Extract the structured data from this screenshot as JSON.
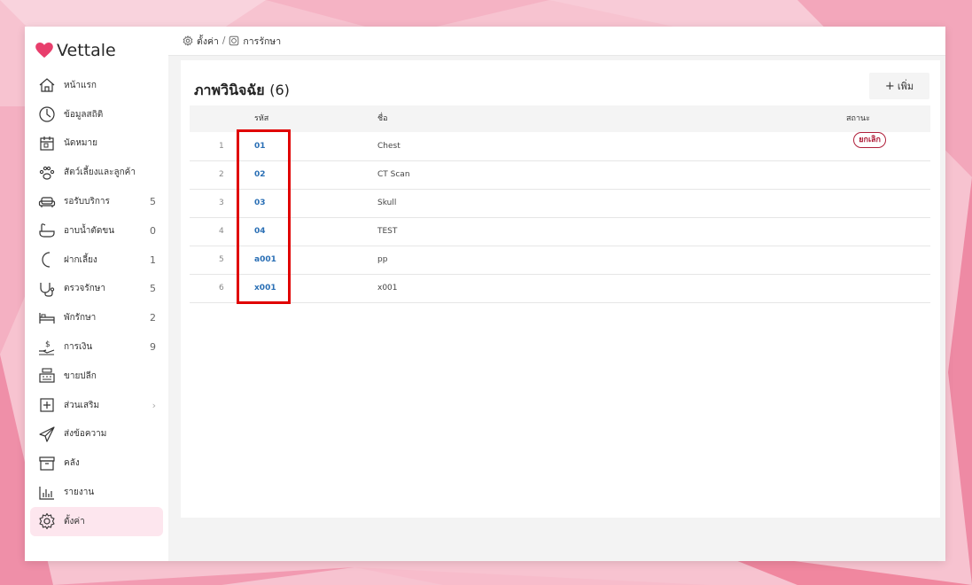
{
  "brand": {
    "name": "Vettale",
    "accent": "#e83e6c"
  },
  "sidebar": {
    "items": [
      {
        "label": "หน้าแรก",
        "count": "",
        "icon": "home-icon"
      },
      {
        "label": "ข้อมูลสถิติ",
        "count": "",
        "icon": "stats-icon"
      },
      {
        "label": "นัดหมาย",
        "count": "",
        "icon": "calendar-icon"
      },
      {
        "label": "สัตว์เลี้ยงและลูกค้า",
        "count": "",
        "icon": "paw-icon"
      },
      {
        "label": "รอรับบริการ",
        "count": "5",
        "icon": "sofa-icon"
      },
      {
        "label": "อาบน้ำตัดขน",
        "count": "0",
        "icon": "bathtub-icon"
      },
      {
        "label": "ฝากเลี้ยง",
        "count": "1",
        "icon": "moon-icon"
      },
      {
        "label": "ตรวจรักษา",
        "count": "5",
        "icon": "stethoscope-icon"
      },
      {
        "label": "พักรักษา",
        "count": "2",
        "icon": "bed-icon"
      },
      {
        "label": "การเงิน",
        "count": "9",
        "icon": "money-hand-icon"
      },
      {
        "label": "ขายปลีก",
        "count": "",
        "icon": "cash-register-icon"
      },
      {
        "label": "ส่วนเสริม",
        "count": "›",
        "icon": "plus-square-icon"
      },
      {
        "label": "ส่งข้อความ",
        "count": "",
        "icon": "send-icon"
      },
      {
        "label": "คลัง",
        "count": "",
        "icon": "archive-icon"
      },
      {
        "label": "รายงาน",
        "count": "",
        "icon": "bar-chart-icon"
      },
      {
        "label": "ตั้งค่า",
        "count": "",
        "icon": "gear-icon"
      }
    ]
  },
  "breadcrumb": {
    "settings": "ตั้งค่า",
    "separator": "/",
    "treatment": "การรักษา"
  },
  "page": {
    "title": "ภาพวินิจฉัย",
    "count": "(6)",
    "add_label": "เพิ่ม",
    "add_symbol": "+"
  },
  "table": {
    "headers": {
      "code": "รหัส",
      "name": "ชื่อ",
      "status": "สถานะ"
    },
    "rows": [
      {
        "num": "1",
        "code": "01",
        "name": "Chest",
        "status": "ยกเลิก"
      },
      {
        "num": "2",
        "code": "02",
        "name": "CT Scan",
        "status": ""
      },
      {
        "num": "3",
        "code": "03",
        "name": "Skull",
        "status": ""
      },
      {
        "num": "4",
        "code": "04",
        "name": "TEST",
        "status": ""
      },
      {
        "num": "5",
        "code": "a001",
        "name": "pp",
        "status": ""
      },
      {
        "num": "6",
        "code": "x001",
        "name": "x001",
        "status": ""
      }
    ]
  },
  "colors": {
    "link": "#2a6fb5",
    "cancel": "#b0203b",
    "highlight": "#e00000",
    "active_bg": "#fde6ee"
  }
}
